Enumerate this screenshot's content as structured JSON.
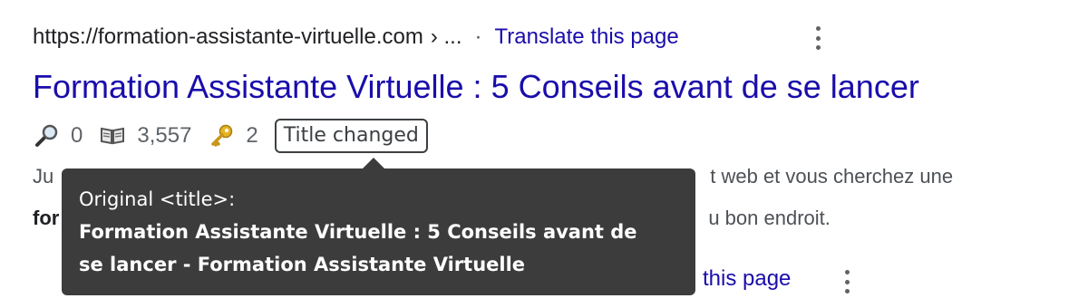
{
  "result": {
    "url": "https://formation-assistante-virtuelle.com",
    "breadcrumb_suffix": "› ...",
    "separator": "·",
    "translate_label": "Translate this page",
    "title": "Formation Assistante Virtuelle : 5 Conseils avant de se lancer"
  },
  "metrics": {
    "search_icon": "magnifier-icon",
    "search_value": "0",
    "book_icon": "book-icon",
    "book_value": "3,557",
    "key_icon": "key-icon",
    "key_value": "2",
    "badge_label": "Title changed"
  },
  "snippet": {
    "line1_start": "Ju",
    "line1_end": "t web et vous cherchez une",
    "line2_start": "for",
    "line2_end": "u bon endroit."
  },
  "tooltip": {
    "heading": "Original <title>:",
    "line1": "Formation Assistante Virtuelle : 5 Conseils avant de",
    "line2": "se lancer - Formation Assistante Virtuelle"
  },
  "second_result": {
    "translate_label_partial": "this page"
  }
}
